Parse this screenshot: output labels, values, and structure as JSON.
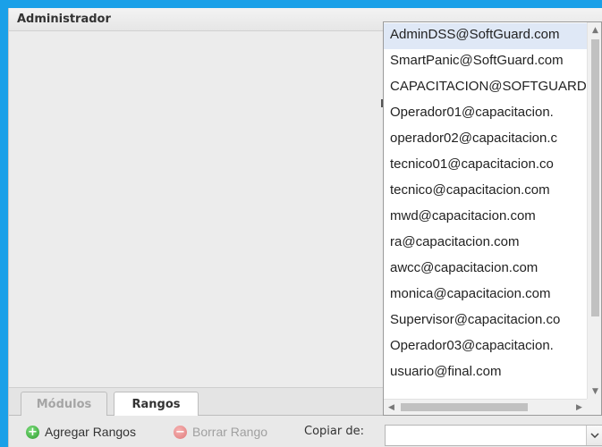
{
  "panel": {
    "title": "Administrador"
  },
  "tabs": [
    {
      "label": "Módulos",
      "active": false
    },
    {
      "label": "Rangos",
      "active": true
    }
  ],
  "toolbar": {
    "add_label": "Agregar Rangos",
    "add_icon": "add-circle-icon",
    "delete_label": "Borrar Rango",
    "delete_icon": "remove-circle-icon",
    "copy_label": "Copiar de:",
    "copy_value": ""
  },
  "dropdown": {
    "items": [
      "AdminDSS@SoftGuard.com",
      "SmartPanic@SoftGuard.com",
      "CAPACITACION@SOFTGUARD",
      "Operador01@capacitacion.",
      "operador02@capacitacion.c",
      "tecnico01@capacitacion.co",
      "tecnico@capacitacion.com",
      "mwd@capacitacion.com",
      "ra@capacitacion.com",
      "awcc@capacitacion.com",
      "monica@capacitacion.com",
      "Supervisor@capacitacion.co",
      "Operador03@capacitacion.",
      "usuario@final.com"
    ],
    "selected_index": 0
  },
  "colors": {
    "frame": "#1aa0e8",
    "selected_row": "#dfe8f6",
    "panel_bg": "#ececec"
  }
}
